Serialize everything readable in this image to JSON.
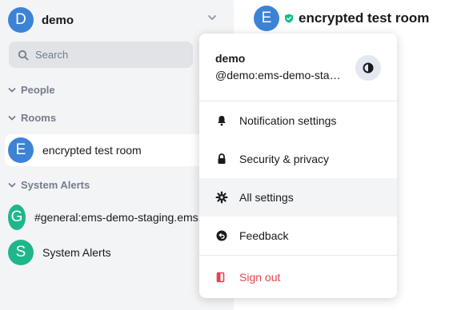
{
  "user": {
    "initial": "D",
    "name": "demo",
    "mxid": "@demo:ems-demo-staging.ems.host"
  },
  "search": {
    "placeholder": "Search"
  },
  "sections": {
    "people": "People",
    "rooms": "Rooms",
    "system_alerts": "System Alerts"
  },
  "rooms": [
    {
      "initial": "E",
      "label": "encrypted test room",
      "color": "#3c83d6"
    },
    {
      "initial": "G",
      "label": "#general:ems-demo-staging.ems.host",
      "color": "#1fb68b"
    },
    {
      "initial": "S",
      "label": "System Alerts",
      "color": "#1fb68b"
    }
  ],
  "main": {
    "room_initial": "E",
    "room_title": "encrypted test room"
  },
  "menu": {
    "name": "demo",
    "mxid": "@demo:ems-demo-staging.ems.host",
    "items": {
      "notifications": "Notification settings",
      "security": "Security & privacy",
      "all_settings": "All settings",
      "feedback": "Feedback",
      "sign_out": "Sign out"
    }
  },
  "colors": {
    "accent": "#0dbd8b",
    "danger": "#e5434f",
    "sidebar_bg": "#f3f4f6"
  }
}
